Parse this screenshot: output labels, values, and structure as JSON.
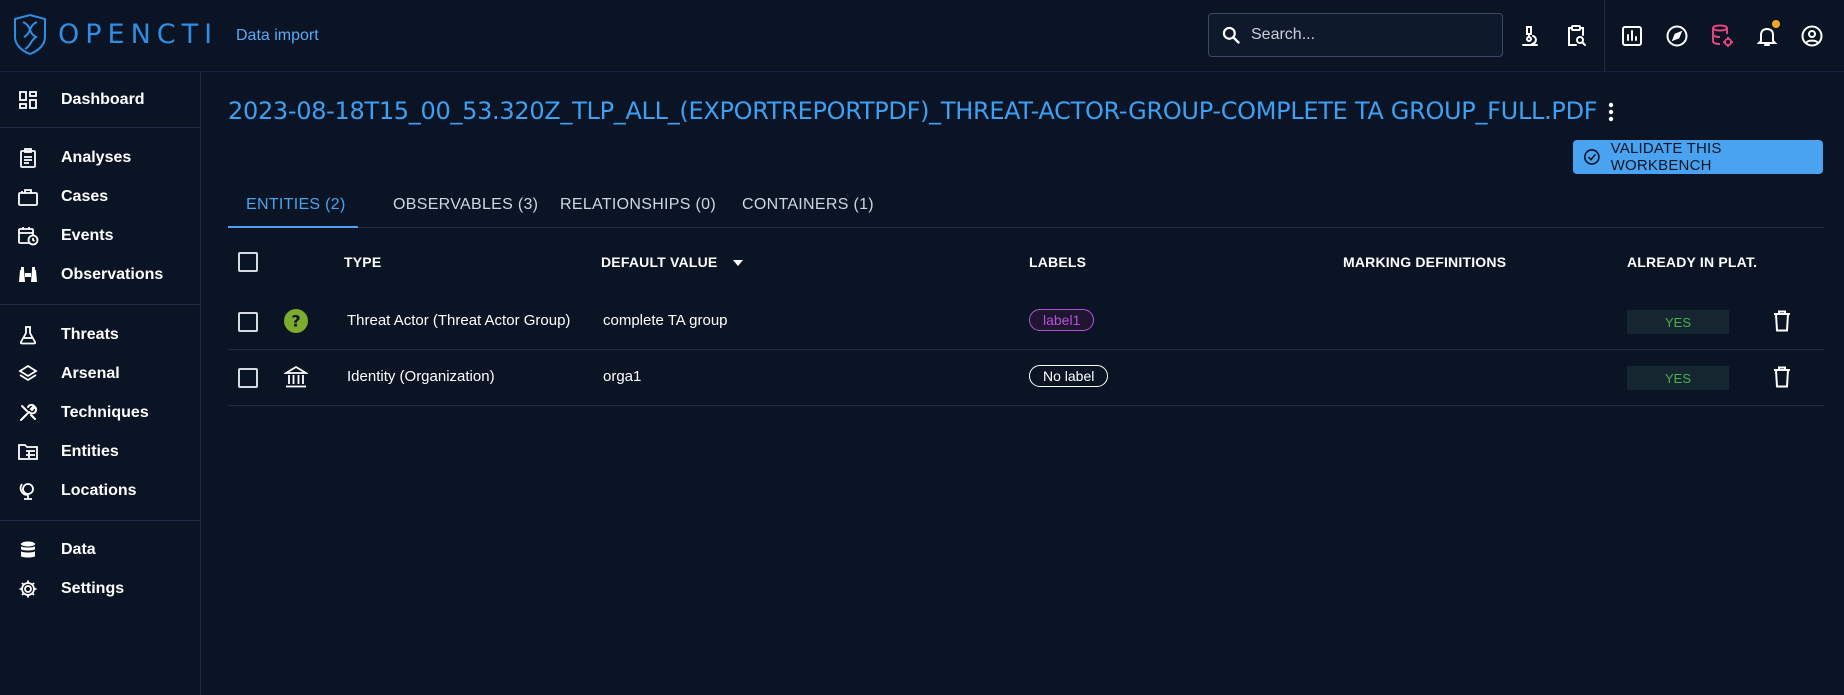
{
  "app": {
    "logo_text": "OPENCTI"
  },
  "topbar": {
    "breadcrumb": "Data import",
    "search": {
      "placeholder": "Search...",
      "value": ""
    },
    "icons": [
      "search-icon",
      "microscope-icon",
      "clipboard-search-icon",
      "chart-box-icon",
      "compass-icon",
      "database-cog-icon",
      "bell-icon",
      "account-circle-icon"
    ],
    "colors": {
      "accent": "#3ea0f2",
      "database_icon": "#e0457b",
      "notification_dot": "#f5a623"
    }
  },
  "sidebar": {
    "items": [
      {
        "label": "Dashboard",
        "icon": "dashboard-icon"
      },
      {
        "label": "Analyses",
        "icon": "clipboard-text-icon"
      },
      {
        "label": "Cases",
        "icon": "briefcase-icon"
      },
      {
        "label": "Events",
        "icon": "calendar-clock-icon"
      },
      {
        "label": "Observations",
        "icon": "binoculars-icon"
      },
      {
        "label": "Threats",
        "icon": "flask-icon"
      },
      {
        "label": "Arsenal",
        "icon": "layers-icon"
      },
      {
        "label": "Techniques",
        "icon": "tools-icon"
      },
      {
        "label": "Entities",
        "icon": "folder-table-icon"
      },
      {
        "label": "Locations",
        "icon": "globe-model-icon"
      },
      {
        "label": "Data",
        "icon": "database-icon"
      },
      {
        "label": "Settings",
        "icon": "cog-icon"
      }
    ]
  },
  "main": {
    "title": "2023-08-18T15_00_53.320Z_TLP_ALL_(EXPORTREPORTPDF)_THREAT-ACTOR-GROUP-COMPLETE TA GROUP_FULL.PDF",
    "validate_button": "VALIDATE THIS WORKBENCH",
    "tabs": [
      {
        "label": "ENTITIES (2)",
        "active": true
      },
      {
        "label": "OBSERVABLES (3)",
        "active": false
      },
      {
        "label": "RELATIONSHIPS (0)",
        "active": false
      },
      {
        "label": "CONTAINERS (1)",
        "active": false
      }
    ],
    "table": {
      "headers": {
        "type": "TYPE",
        "default_value": "DEFAULT VALUE",
        "labels": "LABELS",
        "marking_definitions": "MARKING DEFINITIONS",
        "already_in_platform": "ALREADY IN PLAT."
      },
      "sort": {
        "column": "default_value",
        "direction": "desc"
      },
      "rows": [
        {
          "icon": "threat-actor-question-icon",
          "type": "Threat Actor (Threat Actor Group)",
          "default_value": "complete TA group",
          "label": "label1",
          "label_color": "#b455d6",
          "marking": "",
          "already_in_platform": "YES"
        },
        {
          "icon": "bank-building-icon",
          "type": "Identity (Organization)",
          "default_value": "orga1",
          "label": "No label",
          "label_color": "#ffffff",
          "marking": "",
          "already_in_platform": "YES"
        }
      ]
    }
  }
}
